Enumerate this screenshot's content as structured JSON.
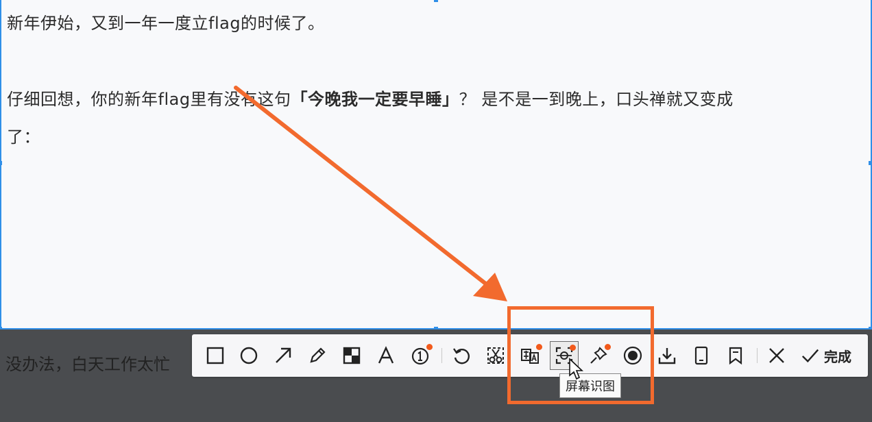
{
  "document": {
    "line1": "新年伊始，又到一年一度立flag的时候了。",
    "line2_prefix": "仔细回想，你的新年flag里有没有这句",
    "line2_bold": "「今晚我一定要早睡」",
    "line2_suffix": "？ 是不是一到晚上，口头禅就又变成",
    "line3": "了：",
    "below_text": "没办法，白天工作太忙"
  },
  "toolbar": {
    "tools": [
      {
        "name": "rectangle-tool",
        "icon": "rectangle-icon"
      },
      {
        "name": "ellipse-tool",
        "icon": "ellipse-icon"
      },
      {
        "name": "arrow-tool",
        "icon": "arrow-icon"
      },
      {
        "name": "pen-tool",
        "icon": "pencil-icon"
      },
      {
        "name": "mosaic-tool",
        "icon": "mosaic-icon"
      },
      {
        "name": "text-tool",
        "icon": "text-icon"
      },
      {
        "name": "number-marker-tool",
        "icon": "numbered-circle-icon",
        "new": true
      },
      {
        "name": "undo-tool",
        "icon": "undo-icon"
      },
      {
        "name": "scissors-tool",
        "icon": "scissors-icon"
      },
      {
        "name": "translate-tool",
        "icon": "translate-icon",
        "new": true
      },
      {
        "name": "screen-recognize-tool",
        "icon": "screen-recognize-icon",
        "new": true,
        "active": true
      },
      {
        "name": "pin-tool",
        "icon": "pin-icon",
        "new": true
      },
      {
        "name": "record-tool",
        "icon": "record-icon"
      },
      {
        "name": "download-tool",
        "icon": "download-icon"
      },
      {
        "name": "device-tool",
        "icon": "tablet-icon"
      },
      {
        "name": "bookmark-tool",
        "icon": "bookmark-icon"
      },
      {
        "name": "close-tool",
        "icon": "close-icon"
      }
    ],
    "done_label": "完成",
    "tooltip": "屏幕识图"
  },
  "colors": {
    "accent_orange": "#f26a2e",
    "selection_blue": "#2f8fe8",
    "badge_dot": "#f25a1c"
  }
}
